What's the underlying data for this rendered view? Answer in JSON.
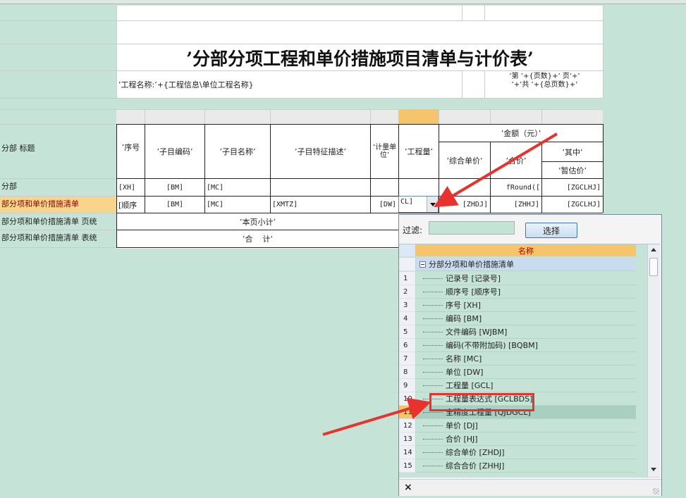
{
  "report": {
    "title": "’分部分项工程和单价措施项目清单与计价表’",
    "project_name": "’工程名称:’+{工程信息\\单位工程名称}",
    "page_info_line1": "’第 ’+{页数}+’ 页’+’",
    "page_info_line2": "’+’共 ’+{总页数}+’",
    "row_labels": [
      "分部 标题",
      "分部",
      "部分项和单价措施清单",
      "部分项和单价措施清单 页统",
      "部分项和单价措施清单 表统"
    ],
    "headers": {
      "seq": "’序号",
      "code": "’子目编码’",
      "name": "’子目名称’",
      "desc": "’子目特征描述’",
      "unit": "’计量单位’",
      "qty": "’工程量’",
      "amount": "’金额（元）’",
      "unit_price": "’综合单价’",
      "total": "’合价’",
      "of_which": "’其中’",
      "prov": "’暂估价’"
    },
    "row_fenbu": {
      "seq": "[XH]",
      "code": "[BM]",
      "name": "[MC]",
      "total": "fRound([",
      "prov": "[ZGCLHJ]"
    },
    "row_qingdan": {
      "seq": "[顺序",
      "code": "[BM]",
      "name": "[MC]",
      "desc": "[XMTZ]",
      "unit": "[DW]",
      "qty": "CL]",
      "unit_price": "[ZHDJ]",
      "total": "[ZHHJ]",
      "prov": "[ZGCLHJ]"
    },
    "page_subtotal": "’本页小计’",
    "grand_total": "’合    计’"
  },
  "popup": {
    "filter_label": "过滤:",
    "filter_value": "",
    "select_button": "选择",
    "column_header": "名称",
    "group_label": "分部分项和单价措施清单",
    "selected_index": 11,
    "highlighted_index": 10,
    "items": [
      {
        "n": "1",
        "label": "记录号 [记录号]"
      },
      {
        "n": "2",
        "label": "顺序号 [顺序号]"
      },
      {
        "n": "3",
        "label": "序号 [XH]"
      },
      {
        "n": "4",
        "label": "编码 [BM]"
      },
      {
        "n": "5",
        "label": "文件编码 [WJBM]"
      },
      {
        "n": "6",
        "label": "编码(不带附加码) [BQBM]"
      },
      {
        "n": "7",
        "label": "名称 [MC]"
      },
      {
        "n": "8",
        "label": "单位 [DW]"
      },
      {
        "n": "9",
        "label": "工程量 [GCL]"
      },
      {
        "n": "10",
        "label": "工程量表达式 [GCLBDS]"
      },
      {
        "n": "11",
        "label": "全精度工程量 [QJDGCL]"
      },
      {
        "n": "12",
        "label": "单价 [DJ]"
      },
      {
        "n": "13",
        "label": "合价 [HJ]"
      },
      {
        "n": "14",
        "label": "综合单价 [ZHDJ]"
      },
      {
        "n": "15",
        "label": "综合合价 [ZHHJ]"
      }
    ],
    "close_glyph": "×"
  },
  "colors": {
    "background": "#c5e3d7",
    "highlight_red": "#e8322d",
    "selected_row": "#f6c46a",
    "active_row_label": "#f7d58c"
  }
}
